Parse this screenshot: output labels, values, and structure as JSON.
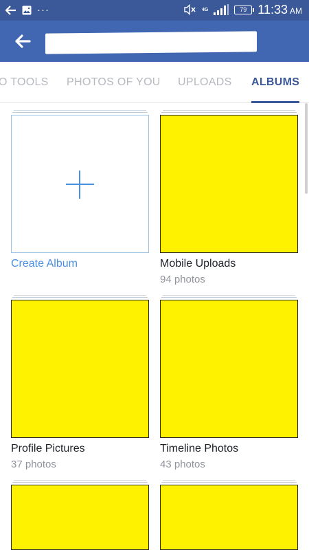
{
  "status_bar": {
    "time": "11:33",
    "ampm": "AM",
    "battery": "79",
    "network": "4G",
    "icons": [
      "back-arrow-icon",
      "image-icon",
      "overflow-dots-icon",
      "mute-icon",
      "signal-icon",
      "battery-icon"
    ]
  },
  "app_bar": {
    "back_icon": "back-arrow-icon",
    "title_redacted": true,
    "color": "#4267b2"
  },
  "tabs": [
    {
      "label": "O TOOLS",
      "active": false
    },
    {
      "label": "PHOTOS OF YOU",
      "active": false
    },
    {
      "label": "UPLOADS",
      "active": false
    },
    {
      "label": "ALBUMS",
      "active": true
    }
  ],
  "albums": [
    {
      "name": "Create Album",
      "count": "",
      "type": "create",
      "icon": "plus-icon"
    },
    {
      "name": "Mobile Uploads",
      "count": "94 photos",
      "type": "album",
      "cover_color": "#fff200"
    },
    {
      "name": "Profile Pictures",
      "count": "37 photos",
      "type": "album",
      "cover_color": "#fff200"
    },
    {
      "name": "Timeline Photos",
      "count": "43 photos",
      "type": "album",
      "cover_color": "#fff200"
    },
    {
      "name": "",
      "count": "",
      "type": "album",
      "cover_color": "#fff200"
    },
    {
      "name": "",
      "count": "",
      "type": "album",
      "cover_color": "#fff200"
    }
  ],
  "colors": {
    "brand": "#3b5998",
    "accent": "#4a90e2",
    "tab_inactive": "#b5b9c0",
    "subtext": "#90949c"
  }
}
